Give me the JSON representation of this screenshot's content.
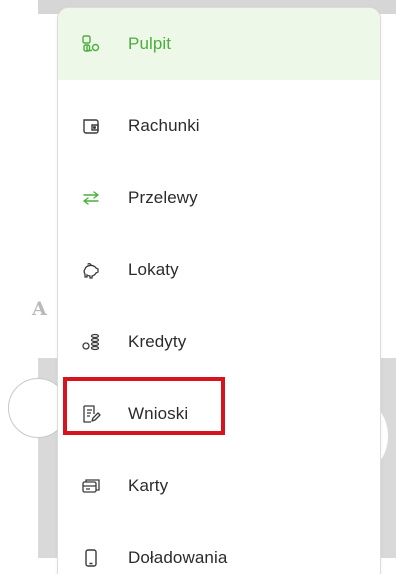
{
  "background": {
    "letter": "A"
  },
  "menu": {
    "items": [
      {
        "label": "Pulpit",
        "icon": "dashboard-icon",
        "active": true
      },
      {
        "label": "Rachunki",
        "icon": "wallet-icon",
        "active": false
      },
      {
        "label": "Przelewy",
        "icon": "transfer-arrows-icon",
        "active": false
      },
      {
        "label": "Lokaty",
        "icon": "piggy-bank-icon",
        "active": false
      },
      {
        "label": "Kredyty",
        "icon": "coins-icon",
        "active": false
      },
      {
        "label": "Wnioski",
        "icon": "application-form-icon",
        "active": false,
        "highlighted": true
      },
      {
        "label": "Karty",
        "icon": "cards-icon",
        "active": false
      },
      {
        "label": "Doładowania",
        "icon": "phone-icon",
        "active": false
      }
    ]
  },
  "colors": {
    "accent": "#4bae3d",
    "active_bg": "#eef8e8",
    "highlight": "#d7141e",
    "text": "#2b2b2b"
  }
}
